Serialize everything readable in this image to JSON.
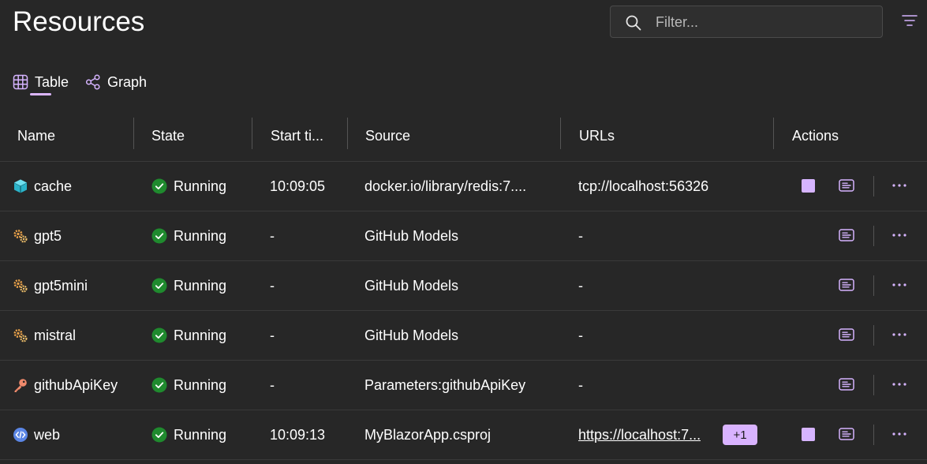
{
  "page": {
    "title": "Resources"
  },
  "filter": {
    "placeholder": "Filter..."
  },
  "tabs": [
    {
      "label": "Table",
      "selected": true
    },
    {
      "label": "Graph",
      "selected": false
    }
  ],
  "columns": [
    "Name",
    "State",
    "Start ti...",
    "Source",
    "URLs",
    "Actions"
  ],
  "rows": [
    {
      "icon": "cube-icon",
      "name": "cache",
      "state": "Running",
      "start": "10:09:05",
      "source": "docker.io/library/redis:7....",
      "url": "tcp://localhost:56326",
      "url_link": false,
      "badge": "",
      "stop": true
    },
    {
      "icon": "gears-icon",
      "name": "gpt5",
      "state": "Running",
      "start": "-",
      "source": "GitHub Models",
      "url": "-",
      "url_link": false,
      "badge": "",
      "stop": false
    },
    {
      "icon": "gears-icon",
      "name": "gpt5mini",
      "state": "Running",
      "start": "-",
      "source": "GitHub Models",
      "url": "-",
      "url_link": false,
      "badge": "",
      "stop": false
    },
    {
      "icon": "gears-icon",
      "name": "mistral",
      "state": "Running",
      "start": "-",
      "source": "GitHub Models",
      "url": "-",
      "url_link": false,
      "badge": "",
      "stop": false
    },
    {
      "icon": "key-icon",
      "name": "githubApiKey",
      "state": "Running",
      "start": "-",
      "source": "Parameters:githubApiKey",
      "url": "-",
      "url_link": false,
      "badge": "",
      "stop": false
    },
    {
      "icon": "code-icon",
      "name": "web",
      "state": "Running",
      "start": "10:09:13",
      "source": "MyBlazorApp.csproj",
      "url": "https://localhost:7...",
      "url_link": true,
      "badge": "+1",
      "stop": true
    }
  ],
  "colors": {
    "accent": "#d6b4ff",
    "running": "#3fb950",
    "background": "#272727"
  }
}
